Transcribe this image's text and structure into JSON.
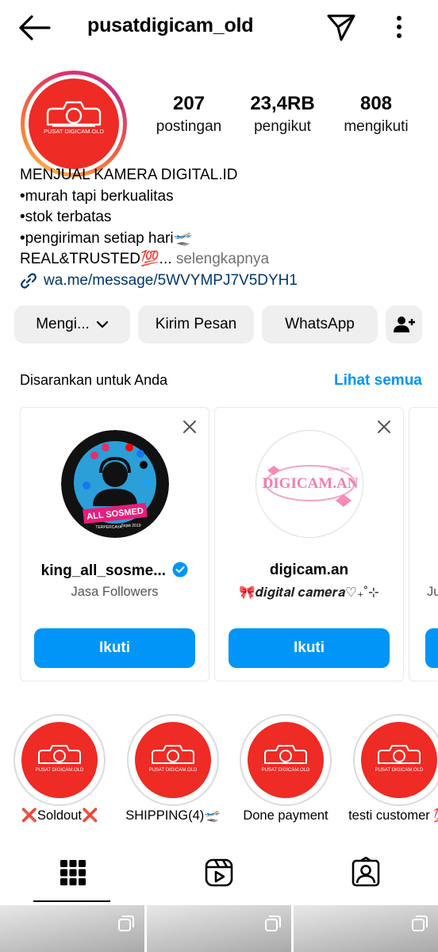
{
  "header": {
    "username": "pusatdigicam_old",
    "back_icon": "arrow-left-icon",
    "send_icon": "paper-plane-icon",
    "more_icon": "more-vertical-icon"
  },
  "profile": {
    "avatar_text": "PUSAT DIGICAM.OLD",
    "stats": [
      {
        "value": "207",
        "label": "postingan"
      },
      {
        "value": "23,4RB",
        "label": "pengikut"
      },
      {
        "value": "808",
        "label": "mengikuti"
      }
    ],
    "bio": {
      "line1": "MENJUAL KAMERA DIGITAL.ID",
      "line2": "•murah tapi berkualitas",
      "line3": "•stok terbatas",
      "line4": "•pengiriman setiap hari🛫",
      "line5": "REAL&TRUSTED💯...",
      "more": "selengkapnya",
      "link": "wa.me/message/5WVYMPJ7V5DYH1"
    }
  },
  "actions": {
    "following": "Mengi...",
    "message": "Kirim Pesan",
    "whatsapp": "WhatsApp"
  },
  "suggestions": {
    "title": "Disarankan untuk Anda",
    "see_all": "Lihat semua",
    "cards": [
      {
        "name": "king_all_sosme...",
        "subtitle": "Jasa Followers",
        "button": "Ikuti",
        "verified": true,
        "badge_text": "ALL SOSMED",
        "badge_sub": "TERPERCAYA",
        "badge_since": "Sejak 2019"
      },
      {
        "name": "digicam.an",
        "subtitle": "🎀𝒅𝒊𝒈𝒊𝒕𝒂𝒍 𝒄𝒂𝒎𝒆𝒓𝒂♡₊˚⊹",
        "button": "Ikuti",
        "verified": false,
        "logo_text": "DIGICAM.AN",
        "logo_since": "since 2024"
      },
      {
        "name": "",
        "subtitle": "Ju",
        "button": "",
        "verified": false
      }
    ]
  },
  "highlights": [
    {
      "label": "❌Soldout❌"
    },
    {
      "label": "SHIPPING(4)🛫"
    },
    {
      "label": "Done payment"
    },
    {
      "label": "testi customer 💯"
    }
  ],
  "tabs": [
    {
      "icon": "grid-icon",
      "active": true
    },
    {
      "icon": "reels-icon",
      "active": false
    },
    {
      "icon": "tagged-icon",
      "active": false
    }
  ],
  "colors": {
    "accent": "#0095f6",
    "brand_red": "#ee2b24",
    "button_bg": "#efefef",
    "link": "#00376b"
  }
}
